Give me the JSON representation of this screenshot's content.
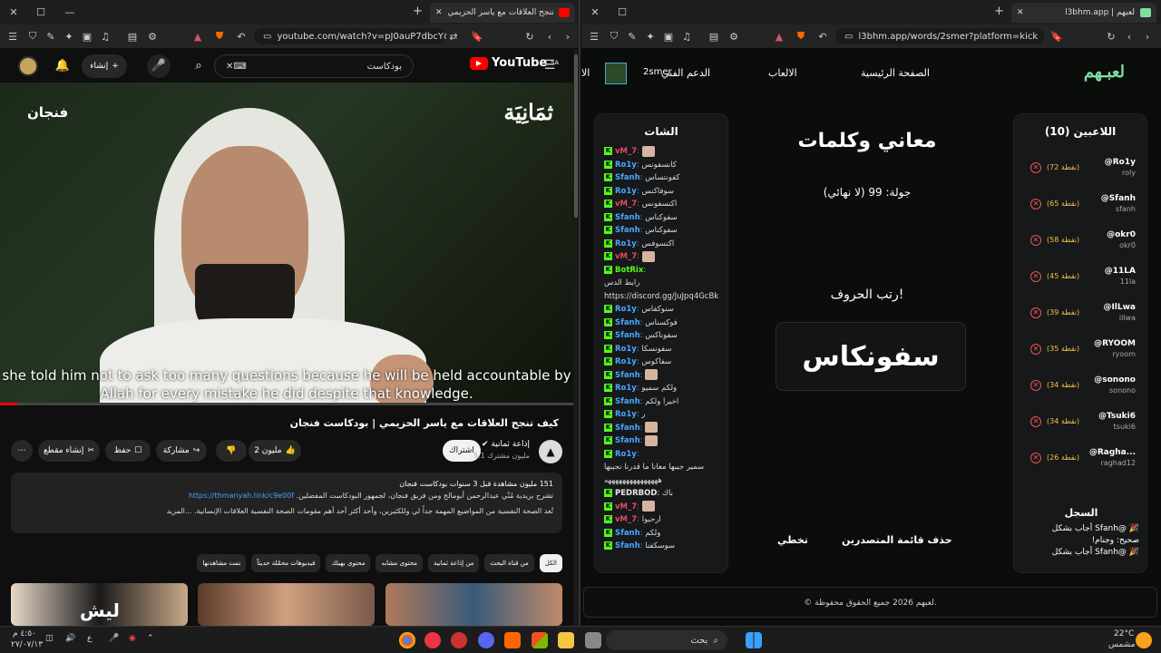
{
  "left_window": {
    "tab_title": "كيف تنجح العلاقات مع ياسر الحزيمي ...",
    "url": "youtube.com/watch?v=pJ0auP7dbcY&t=4...",
    "youtube": {
      "logo": "YouTube",
      "region": "SA",
      "search_text": "بودكاست",
      "create_label": "إنشاء",
      "brand_left": "فنجان",
      "brand_right": "ثمَانِيَة",
      "caption_line1": "she told him not to ask too many questions because he will be held accountable by",
      "caption_line2": "Allah for every mistake he did despite that knowledge.",
      "progress": 0.03,
      "video_title": "كيف تنجح العلاقات مع ياسر الحزيمي | بودكاست فنجان",
      "channel_name": "إذاعة ثمانية",
      "channel_subs": "5.1 مليون مشترك",
      "subscribe_label": "اشتراك",
      "likes_label": "2 مليون",
      "share_label": "مشاركة",
      "save_label": "حفظ",
      "clip_label": "إنشاء مقطع",
      "desc_stats": "151 مليون مشاهدة  قبل 3 سنوات  بودكاست فنجان",
      "desc_line1": "تشرح بريدية مُنّي عبدالرحمن أبومالح ومن فريق فنجان، لجمهور البودكاست المفضلين.",
      "desc_link": "https://thmanyah.link/c9e00f",
      "desc_line2": "تُعد الصحة النفسية من المواضيع المهمة جداً لي وللكثيرين، وأحد أكثر أحد أهم مقومات الصحة النفسية العلاقات الإنسانية. ...المزيد",
      "chips": [
        "الكل",
        "من قناة البحث",
        "من إذاعة ثمانية",
        "محتوى مشابه",
        "محتوى بهيئك",
        "فيديوهات محمّلة حديثاً",
        "تمت مشاهدتها"
      ],
      "thumb_text": "ليش"
    }
  },
  "right_window": {
    "tab_title": "l3bhm.app | لعبهم",
    "url": "l3bhm.app/words/2smer?platform=kick",
    "nav": {
      "logo": "لعبـهم",
      "home": "الصفحة الرئيسية",
      "games": "الالعاب",
      "support": "الدعم الفني",
      "user": "2smer",
      "extra": "الا"
    },
    "chat": {
      "title": "الشات",
      "lines": [
        {
          "user": "vM_7",
          "color": "#e84a5f",
          "msg": "",
          "emote": true
        },
        {
          "user": "Ro1y",
          "color": "#4aa8ff",
          "msg": "كانسفونس"
        },
        {
          "user": "Sfanh",
          "color": "#4aa8ff",
          "msg": "كفونتساس"
        },
        {
          "user": "Ro1y",
          "color": "#4aa8ff",
          "msg": "سوفاكنس"
        },
        {
          "user": "vM_7",
          "color": "#e84a5f",
          "msg": "اكنسفونس"
        },
        {
          "user": "Sfanh",
          "color": "#4aa8ff",
          "msg": "سفوكناس"
        },
        {
          "user": "Sfanh",
          "color": "#4aa8ff",
          "msg": "سفوكناس"
        },
        {
          "user": "Ro1y",
          "color": "#4aa8ff",
          "msg": "اكنسوفس"
        },
        {
          "user": "vM_7",
          "color": "#e84a5f",
          "msg": "",
          "emote": true
        },
        {
          "user": "BotRix",
          "color": "#53fc18",
          "msg": ""
        },
        {
          "user": "",
          "color": "#ddd",
          "msg": "رابط الدس"
        },
        {
          "user": "",
          "color": "#ddd",
          "msg": "https://discord.gg/JuJpq4GcBk"
        },
        {
          "user": "Ro1y",
          "color": "#4aa8ff",
          "msg": "سنوكفاس"
        },
        {
          "user": "Sfanh",
          "color": "#4aa8ff",
          "msg": "فوكسناس"
        },
        {
          "user": "Sfanh",
          "color": "#4aa8ff",
          "msg": "سفوناكس"
        },
        {
          "user": "Ro1y",
          "color": "#4aa8ff",
          "msg": "سفونسكا"
        },
        {
          "user": "Ro1y",
          "color": "#4aa8ff",
          "msg": "سفاكوس"
        },
        {
          "user": "Sfanh",
          "color": "#4aa8ff",
          "msg": "",
          "emote": true
        },
        {
          "user": "Ro1y",
          "color": "#4aa8ff",
          "msg": "ولكم سميو"
        },
        {
          "user": "Sfanh",
          "color": "#4aa8ff",
          "msg": "اخيرا ولكم"
        },
        {
          "user": "Ro1y",
          "color": "#4aa8ff",
          "msg": "ر"
        },
        {
          "user": "Sfanh",
          "color": "#4aa8ff",
          "msg": "",
          "emote": true
        },
        {
          "user": "Sfanh",
          "color": "#4aa8ff",
          "msg": "",
          "emote": true
        },
        {
          "user": "Ro1y",
          "color": "#4aa8ff",
          "msg": ""
        },
        {
          "user": "",
          "color": "#ddd",
          "msg": "سمير جيبها معانا ما قدرنا نجيبها"
        },
        {
          "user": "",
          "color": "#ddd",
          "msg": "هههههههههههههههه"
        },
        {
          "user": "PEDRBOD",
          "color": "#e8e8e8",
          "msg": "باك"
        },
        {
          "user": "vM_7",
          "color": "#e84a5f",
          "msg": "",
          "emote": true
        },
        {
          "user": "vM_7",
          "color": "#e84a5f",
          "msg": "ارحبوا"
        },
        {
          "user": "Sfanh",
          "color": "#4aa8ff",
          "msg": "ولكم"
        },
        {
          "user": "Sfanh",
          "color": "#4aa8ff",
          "msg": "سوسكفنا"
        }
      ]
    },
    "game": {
      "title": "معاني وكلمات",
      "round": "جولة: 99 (لا نهائي)",
      "prompt": "رتب الحروف!",
      "word": "سفونكاس",
      "skip_label": "تخطي",
      "clear_label": "حذف قائمة المتصدرين"
    },
    "players": {
      "title": "اللاعبين (10)",
      "list": [
        {
          "handle": "@Ro1y",
          "sub": "roly",
          "pts": "(72 نقطة)"
        },
        {
          "handle": "@Sfanh",
          "sub": "sfanh",
          "pts": "(65 نقطة)"
        },
        {
          "handle": "@okr0",
          "sub": "okr0",
          "pts": "(58 نقطة)"
        },
        {
          "handle": "@11LA",
          "sub": "11la",
          "pts": "(45 نقطة)"
        },
        {
          "handle": "@IlLwa",
          "sub": "illwa",
          "pts": "(39 نقطة)"
        },
        {
          "handle": "@RYOOM",
          "sub": "ryoom",
          "pts": "(35 نقطة)"
        },
        {
          "handle": "@sonono",
          "sub": "sonono",
          "pts": "(34 نقطة)"
        },
        {
          "handle": "@Tsuki6",
          "sub": "tsuki6",
          "pts": "(34 نقطة)"
        },
        {
          "handle": "@Ragha...",
          "sub": "raghad12",
          "pts": "(26 نقطة)"
        }
      ],
      "log_title": "السجل",
      "log": [
        "🎉 @Sfanh أجاب بشكل",
        "صحيح: وجنام!",
        "🎉 @Sfanh أجاب بشكل"
      ]
    },
    "footer": "© لعبهم 2026 جميع الحقوق محفوظة."
  },
  "taskbar": {
    "time": "٤:٥٠ م",
    "date": "٢٧/٠٧/١٣",
    "search": "بحث",
    "weather_temp": "22°C",
    "weather_desc": "مشمس",
    "lang": "ع"
  }
}
